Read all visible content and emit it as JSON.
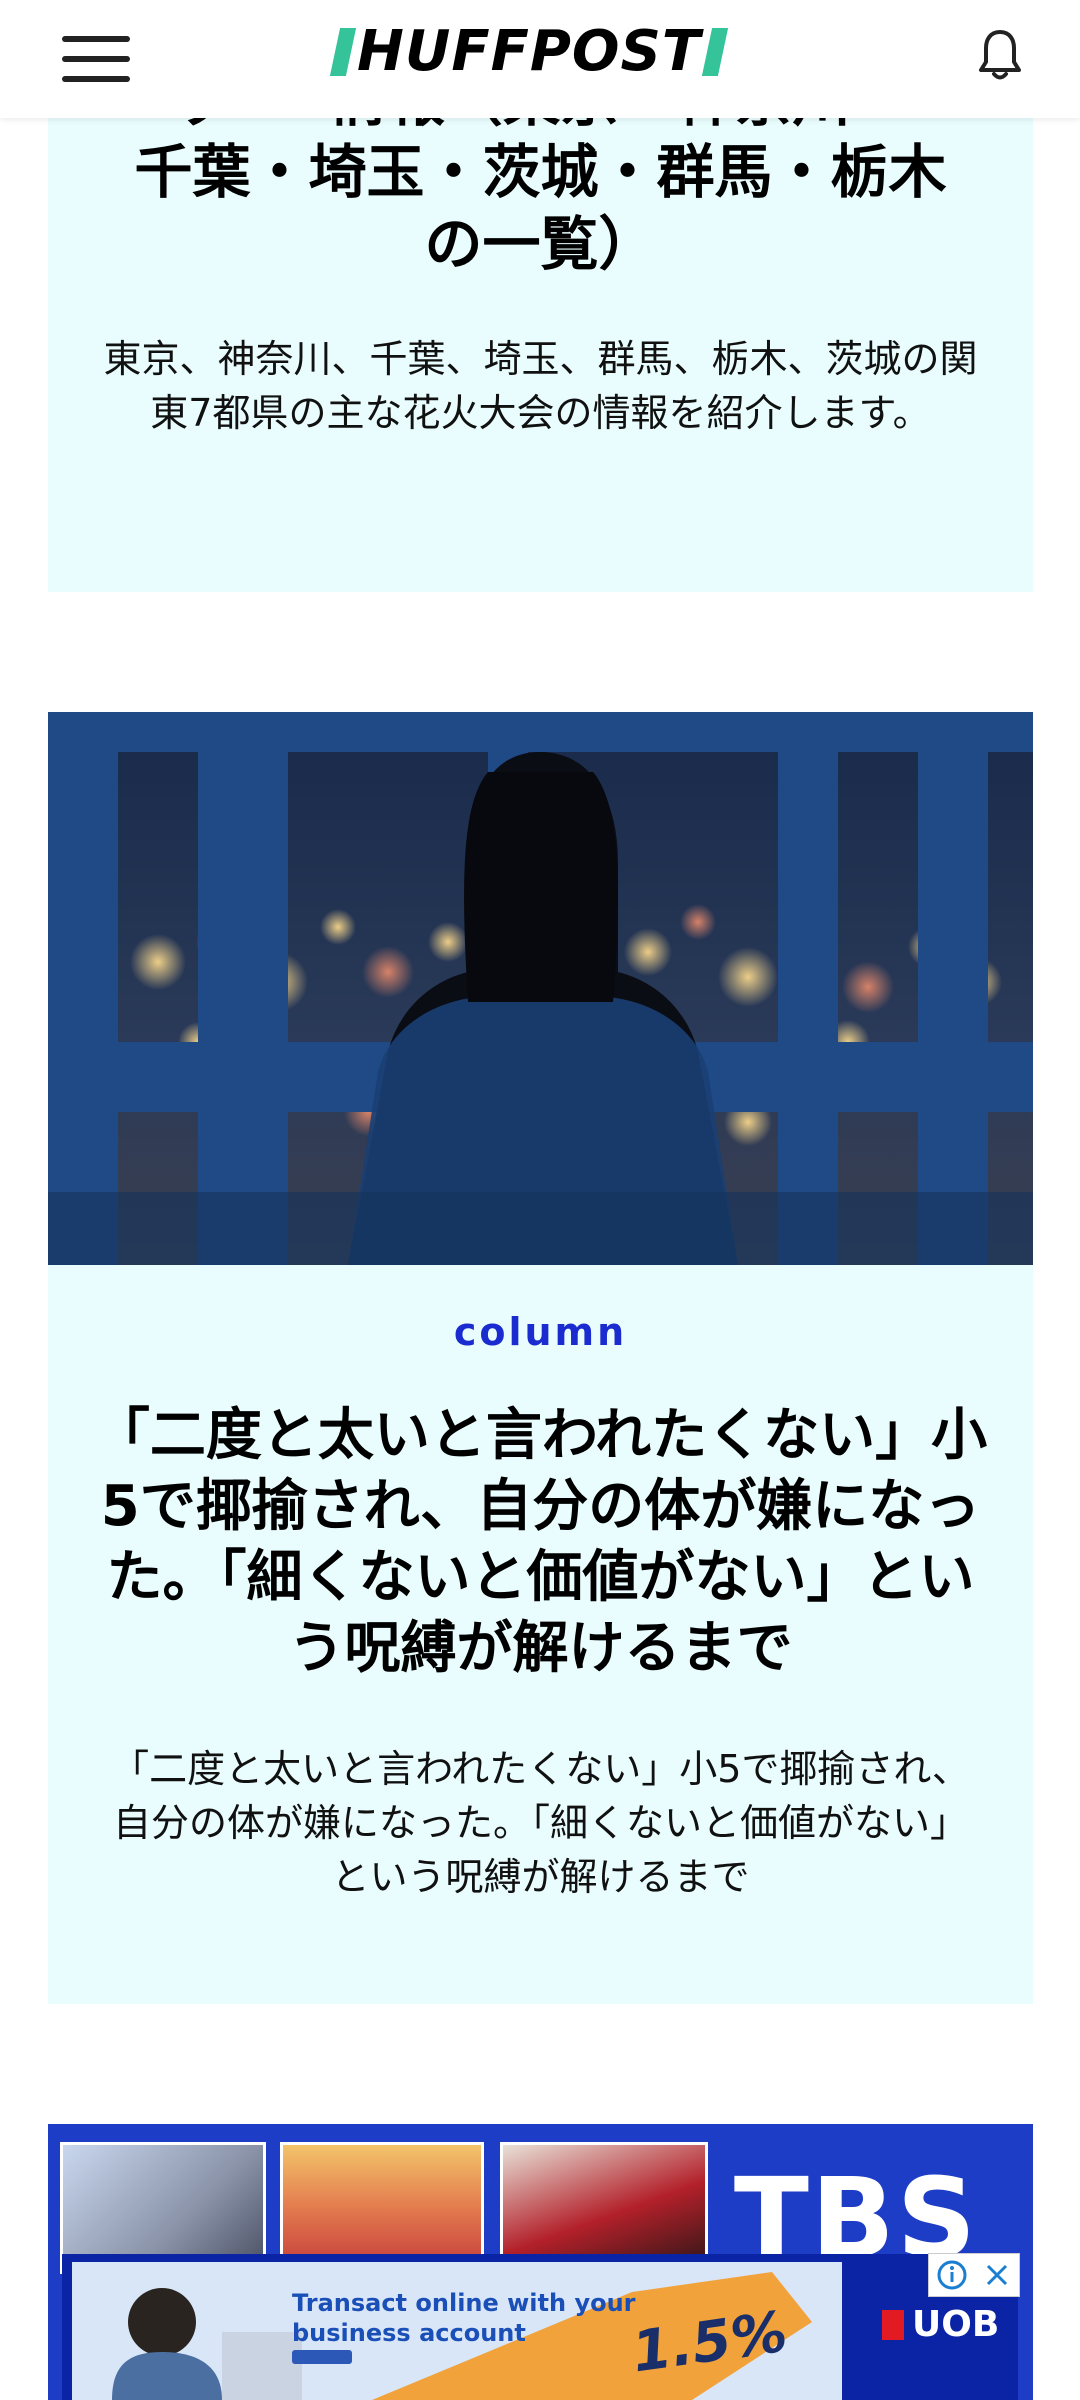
{
  "header": {
    "logo_text": "HUFFPOST",
    "brand_color": "#35c39a"
  },
  "article1": {
    "title_partial": "ッ ー 情報（東京・神奈川・",
    "title": "千葉・埼玉・茨城・群馬・栃木\nの一覧）",
    "description": "東京、神奈川、千葉、埼玉、群馬、栃木、茨城の関東7都県の主な花火大会の情報を紹介します。"
  },
  "article2": {
    "label": "column",
    "label_color": "#1a2ccf",
    "title": "「二度と太いと言われたくない」小5で揶揄され、自分の体が嫌になった。「細くないと価値がない」という呪縛が解けるまで",
    "description": "「二度と太いと言われたくない」小5で揶揄され、自分の体が嫌になった。「細くないと価値がない」という呪縛が解けるまで"
  },
  "ad_banner": {
    "brand": "TBS"
  },
  "ad_overlay": {
    "text": "Transact online with your business account",
    "rate": "1.5%",
    "brand": "UOB"
  },
  "colors": {
    "card_background": "#e9fdfe",
    "ad_background": "#1e3dc7"
  }
}
